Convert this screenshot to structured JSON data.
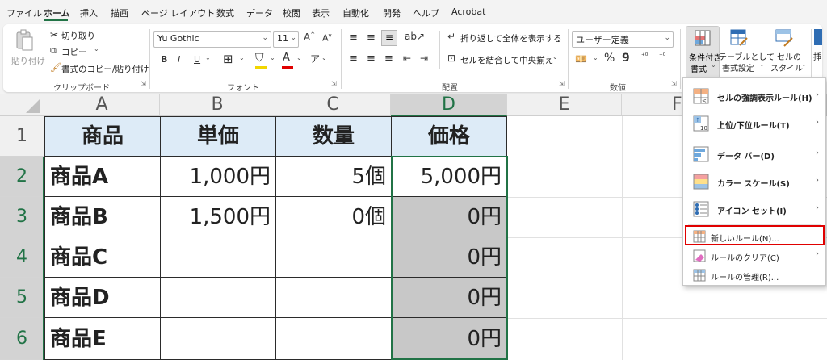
{
  "menu": {
    "tabs": [
      "ファイル",
      "ホーム",
      "挿入",
      "描画",
      "ページ レイアウト",
      "数式",
      "データ",
      "校閲",
      "表示",
      "自動化",
      "開発",
      "ヘルプ",
      "Acrobat"
    ],
    "active": "ホーム"
  },
  "ribbon": {
    "clipboard": {
      "paste_label": "貼り付け",
      "cut_label": "切り取り",
      "copy_label": "コピー",
      "format_painter_label": "書式のコピー/貼り付け",
      "group_label": "クリップボード"
    },
    "font": {
      "font_name": "Yu Gothic",
      "font_size": "11",
      "bold": "B",
      "italic": "I",
      "underline": "U",
      "group_label": "フォント"
    },
    "alignment": {
      "wrap_text_label": "折り返して全体を表示する",
      "merge_center_label": "セルを結合して中央揃え",
      "group_label": "配置"
    },
    "number": {
      "format_value": "ユーザー定義",
      "percent": "%",
      "comma": "9",
      "group_label": "数値"
    },
    "styles": {
      "conditional_formatting_label_1": "条件付き",
      "conditional_formatting_label_2": "書式",
      "format_as_table_label_1": "テーブルとして",
      "format_as_table_label_2": "書式設定",
      "cell_styles_label_1": "セルの",
      "cell_styles_label_2": "スタイル",
      "insert_label": "挿"
    }
  },
  "sheet": {
    "columns": [
      "A",
      "B",
      "C",
      "D",
      "E",
      "F"
    ],
    "rows": [
      "1",
      "2",
      "3",
      "4",
      "5",
      "6"
    ],
    "headers": [
      "商品",
      "単価",
      "数量",
      "価格"
    ],
    "data": [
      {
        "name": "商品A",
        "price": "1,000円",
        "qty": "5個",
        "total": "5,000円"
      },
      {
        "name": "商品B",
        "price": "1,500円",
        "qty": "0個",
        "total": "0円"
      },
      {
        "name": "商品C",
        "price": "",
        "qty": "",
        "total": "0円"
      },
      {
        "name": "商品D",
        "price": "",
        "qty": "",
        "total": "0円"
      },
      {
        "name": "商品E",
        "price": "",
        "qty": "",
        "total": "0円"
      }
    ]
  },
  "dropdown": {
    "items": [
      {
        "label": "セルの強調表示ルール(H)",
        "has_submenu": true
      },
      {
        "label": "上位/下位ルール(T)",
        "has_submenu": true
      },
      {
        "label": "データ バー(D)",
        "has_submenu": true
      },
      {
        "label": "カラー スケール(S)",
        "has_submenu": true
      },
      {
        "label": "アイコン セット(I)",
        "has_submenu": true
      },
      {
        "label": "新しいルール(N)...",
        "has_submenu": false
      },
      {
        "label": "ルールのクリア(C)",
        "has_submenu": true
      },
      {
        "label": "ルールの管理(R)...",
        "has_submenu": false
      }
    ]
  },
  "colors": {
    "accent": "#217346",
    "header_fill": "#ddebf7",
    "gray_fill": "#c8c8c8",
    "highlight": "#e00000"
  }
}
